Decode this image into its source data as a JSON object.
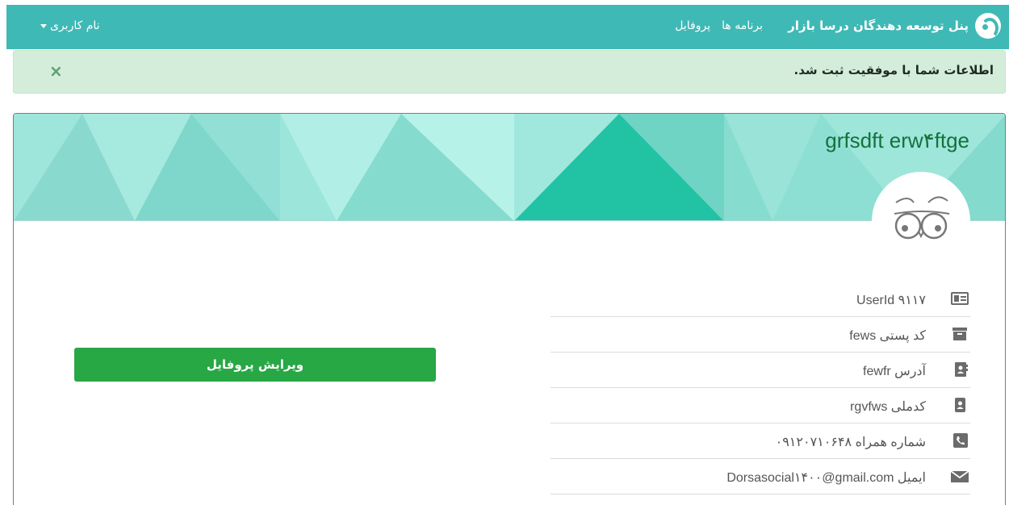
{
  "navbar": {
    "brand": "پنل توسعه دهندگان درسا بازار",
    "links": [
      "برنامه ها",
      "پروفایل"
    ],
    "user_menu": "نام کاربری"
  },
  "alert": {
    "message": "اطلاعات شما با موفقیت ثبت شد.",
    "close": "×"
  },
  "profile": {
    "name": "grfsdft erw۴ftge",
    "fields": [
      {
        "icon": "id-card-icon",
        "text": "UserId ۹۱۱۷"
      },
      {
        "icon": "archive-box-icon",
        "text": "کد پستی fews"
      },
      {
        "icon": "address-book-icon",
        "text": "آدرس fewfr"
      },
      {
        "icon": "id-badge-icon",
        "text": "کدملی rgvfws"
      },
      {
        "icon": "phone-icon",
        "text": "شماره همراه ۰۹۱۲۰۷۱۰۶۴۸"
      },
      {
        "icon": "envelope-icon",
        "text": "ایمیل Dorsasocial۱۴۰۰@gmail.com"
      }
    ],
    "edit_button": "ویرایش پروفایل"
  },
  "colors": {
    "navbar": "#3fb9b6",
    "alert_bg": "#d4edda",
    "button": "#28a745",
    "name": "#14723c"
  }
}
